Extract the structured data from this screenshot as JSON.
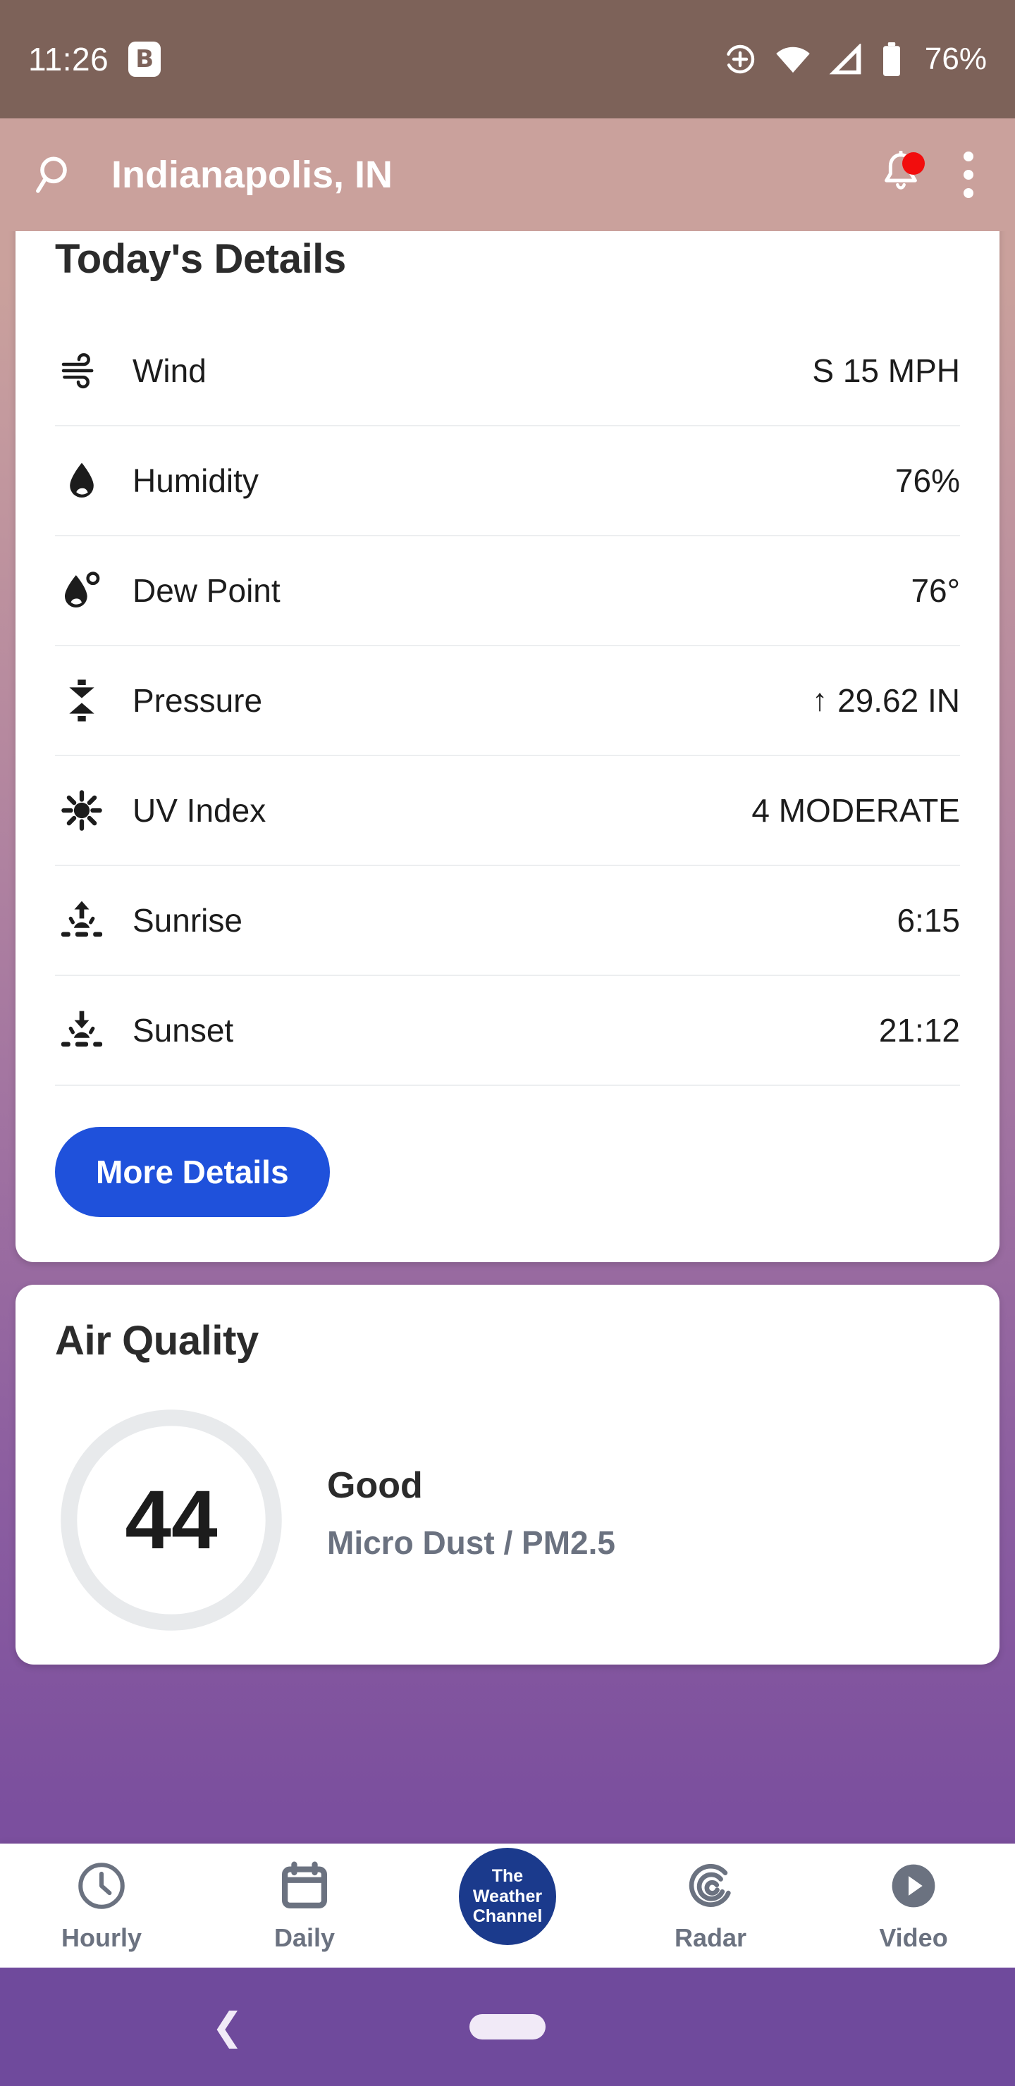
{
  "status_bar": {
    "time": "11:26",
    "app_badge": "B",
    "battery": "76%",
    "icons": [
      "location-add-icon",
      "wifi-icon",
      "cell-signal-icon",
      "battery-icon"
    ]
  },
  "app_bar": {
    "search_icon": "search-icon",
    "location_title": "Indianapolis, IN",
    "alerts_icon": "bell-icon",
    "alerts_badge": true,
    "overflow_icon": "kebab-menu-icon"
  },
  "details_card": {
    "title": "Today's Details",
    "rows": [
      {
        "icon": "wind-icon",
        "label": "Wind",
        "value": "S 15 MPH",
        "trend": ""
      },
      {
        "icon": "droplet-icon",
        "label": "Humidity",
        "value": "76%",
        "trend": ""
      },
      {
        "icon": "dewpoint-icon",
        "label": "Dew Point",
        "value": "76°",
        "trend": ""
      },
      {
        "icon": "pressure-icon",
        "label": "Pressure",
        "value": "29.62 IN",
        "trend": "↑"
      },
      {
        "icon": "uv-sun-icon",
        "label": "UV Index",
        "value": "4 MODERATE",
        "trend": ""
      },
      {
        "icon": "sunrise-icon",
        "label": "Sunrise",
        "value": "6:15",
        "trend": ""
      },
      {
        "icon": "sunset-icon",
        "label": "Sunset",
        "value": "21:12",
        "trend": ""
      }
    ],
    "more_button": "More Details"
  },
  "air_quality_card": {
    "title": "Air Quality",
    "index": "44",
    "category": "Good",
    "pollutant": "Micro Dust / PM2.5"
  },
  "bottom_nav": [
    {
      "icon": "clock-icon",
      "label": "Hourly"
    },
    {
      "icon": "calendar-icon",
      "label": "Daily"
    },
    {
      "icon": "weather-channel-logo",
      "label": "",
      "logo_line1": "The",
      "logo_line2": "Weather",
      "logo_line3": "Channel"
    },
    {
      "icon": "radar-icon",
      "label": "Radar"
    },
    {
      "icon": "video-play-icon",
      "label": "Video"
    }
  ],
  "system_nav": {
    "back_icon": "back-chevron-icon",
    "home_pill": "home-pill-icon"
  },
  "colors": {
    "accent_blue": "#1f51db",
    "brand_navy": "#1b3a8c",
    "badge_red": "#f20d0d",
    "appbar_rose": "#caa19c",
    "statusbar_brown": "#7d6259",
    "background_purple": "#7b4f9e"
  }
}
